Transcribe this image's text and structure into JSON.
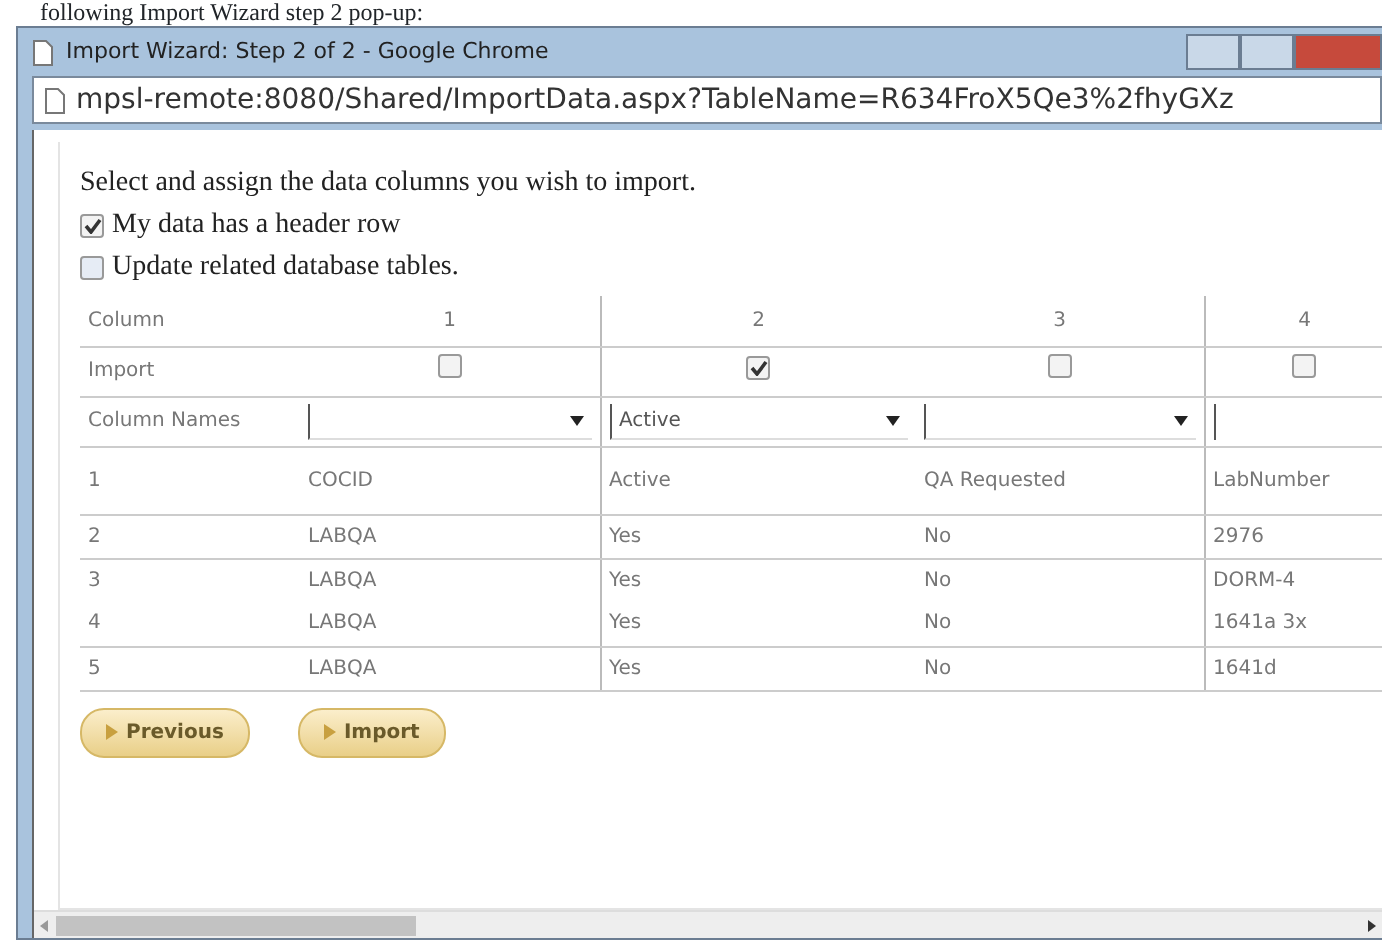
{
  "caption": "following Import Wizard step 2 pop-up:",
  "window": {
    "title": "Import Wizard: Step 2 of 2 - Google Chrome",
    "url": "mpsl-remote:8080/Shared/ImportData.aspx?TableName=R634FroX5Qe3%2fhyGXz"
  },
  "instructions": "Select and assign the data columns you wish to import.",
  "options": [
    {
      "label": "My data has a header row",
      "checked": true
    },
    {
      "label": "Update related database tables.",
      "checked": false
    }
  ],
  "mapping": {
    "column_label": "Column",
    "import_label": "Import",
    "names_label": "Column Names",
    "columns": [
      {
        "number": "1",
        "import": false
      },
      {
        "number": "2",
        "import": true,
        "name": "Active"
      },
      {
        "number": "3",
        "import": false
      },
      {
        "number": "4",
        "import": false
      }
    ]
  },
  "rows": [
    [
      "1",
      "COCID",
      "Active",
      "QA Requested",
      "LabNumber"
    ],
    [
      "2",
      "LABQA",
      "Yes",
      "No",
      "2976"
    ],
    [
      "3",
      "LABQA",
      "Yes",
      "No",
      "DORM-4"
    ],
    [
      "4",
      "LABQA",
      "Yes",
      "No",
      "1641a 3x"
    ],
    [
      "5",
      "LABQA",
      "Yes",
      "No",
      "1641d"
    ]
  ],
  "buttons": [
    "Previous",
    "Import"
  ]
}
